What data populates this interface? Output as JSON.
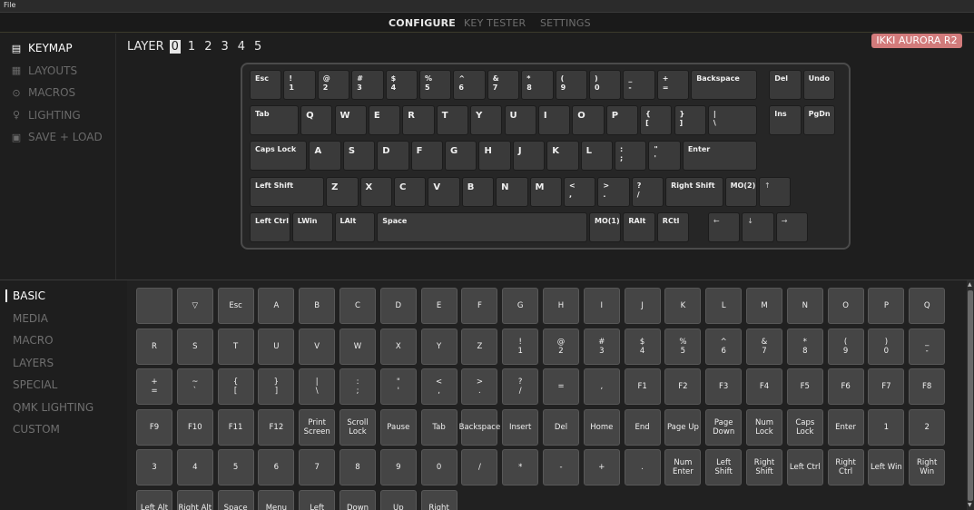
{
  "menubar": {
    "file": "File"
  },
  "topnav": {
    "tabs": [
      {
        "label": "CONFIGURE",
        "active": true
      },
      {
        "label": "KEY TESTER",
        "active": false
      },
      {
        "label": "SETTINGS",
        "active": false
      }
    ]
  },
  "upper_sidebar": {
    "items": [
      {
        "label": "KEYMAP",
        "icon": "keyboard-icon",
        "glyph": "▤",
        "active": true
      },
      {
        "label": "LAYOUTS",
        "icon": "layouts-icon",
        "glyph": "▦",
        "active": false
      },
      {
        "label": "MACROS",
        "icon": "macros-icon",
        "glyph": "⊙",
        "active": false
      },
      {
        "label": "LIGHTING",
        "icon": "lightbulb-icon",
        "glyph": "♀",
        "active": false
      },
      {
        "label": "SAVE + LOAD",
        "icon": "save-icon",
        "glyph": "▣",
        "active": false
      }
    ]
  },
  "layer": {
    "label": "LAYER",
    "numbers": [
      "0",
      "1",
      "2",
      "3",
      "4",
      "5"
    ],
    "selected": "0"
  },
  "keyboard_name": "IKKI AURORA R2",
  "keyboard": {
    "rows": [
      [
        {
          "t": "Esc",
          "w": 1
        },
        {
          "t": "!\n1",
          "w": 1
        },
        {
          "t": "@\n2",
          "w": 1
        },
        {
          "t": "#\n3",
          "w": 1
        },
        {
          "t": "$\n4",
          "w": 1
        },
        {
          "t": "%\n5",
          "w": 1
        },
        {
          "t": "^\n6",
          "w": 1
        },
        {
          "t": "&\n7",
          "w": 1
        },
        {
          "t": "*\n8",
          "w": 1
        },
        {
          "t": "(\n9",
          "w": 1
        },
        {
          "t": ")\n0",
          "w": 1
        },
        {
          "t": "_\n-",
          "w": 1
        },
        {
          "t": "+\n=",
          "w": 1
        },
        {
          "t": "Backspace",
          "w": 2
        },
        {
          "gap": 0.3
        },
        {
          "t": "Del",
          "w": 1
        },
        {
          "t": "Undo",
          "w": 1
        }
      ],
      [
        {
          "t": "Tab",
          "w": 1.5
        },
        {
          "t": "Q",
          "w": 1,
          "big": true
        },
        {
          "t": "W",
          "w": 1,
          "big": true
        },
        {
          "t": "E",
          "w": 1,
          "big": true
        },
        {
          "t": "R",
          "w": 1,
          "big": true
        },
        {
          "t": "T",
          "w": 1,
          "big": true
        },
        {
          "t": "Y",
          "w": 1,
          "big": true
        },
        {
          "t": "U",
          "w": 1,
          "big": true
        },
        {
          "t": "I",
          "w": 1,
          "big": true
        },
        {
          "t": "O",
          "w": 1,
          "big": true
        },
        {
          "t": "P",
          "w": 1,
          "big": true
        },
        {
          "t": "{\n[",
          "w": 1
        },
        {
          "t": "}\n]",
          "w": 1
        },
        {
          "t": "|\n\\",
          "w": 1.5
        },
        {
          "gap": 0.3
        },
        {
          "t": "Ins",
          "w": 1
        },
        {
          "t": "PgDn",
          "w": 1
        }
      ],
      [
        {
          "t": "Caps Lock",
          "w": 1.75
        },
        {
          "t": "A",
          "w": 1,
          "big": true
        },
        {
          "t": "S",
          "w": 1,
          "big": true
        },
        {
          "t": "D",
          "w": 1,
          "big": true
        },
        {
          "t": "F",
          "w": 1,
          "big": true
        },
        {
          "t": "G",
          "w": 1,
          "big": true
        },
        {
          "t": "H",
          "w": 1,
          "big": true
        },
        {
          "t": "J",
          "w": 1,
          "big": true
        },
        {
          "t": "K",
          "w": 1,
          "big": true
        },
        {
          "t": "L",
          "w": 1,
          "big": true
        },
        {
          "t": ":\n;",
          "w": 1
        },
        {
          "t": "\"\n'",
          "w": 1
        },
        {
          "t": "Enter",
          "w": 2.25
        }
      ],
      [
        {
          "t": "Left Shift",
          "w": 2.25
        },
        {
          "t": "Z",
          "w": 1,
          "big": true
        },
        {
          "t": "X",
          "w": 1,
          "big": true
        },
        {
          "t": "C",
          "w": 1,
          "big": true
        },
        {
          "t": "V",
          "w": 1,
          "big": true
        },
        {
          "t": "B",
          "w": 1,
          "big": true
        },
        {
          "t": "N",
          "w": 1,
          "big": true
        },
        {
          "t": "M",
          "w": 1,
          "big": true
        },
        {
          "t": "<\n,",
          "w": 1
        },
        {
          "t": ">\n.",
          "w": 1
        },
        {
          "t": "?\n/",
          "w": 1
        },
        {
          "t": "Right Shift",
          "w": 1.75
        },
        {
          "t": "MO(2)",
          "w": 1
        },
        {
          "gap": 0
        },
        {
          "t": "↑",
          "w": 1,
          "light": true
        }
      ],
      [
        {
          "t": "Left Ctrl",
          "w": 1.25
        },
        {
          "t": "LWin",
          "w": 1.25
        },
        {
          "t": "LAlt",
          "w": 1.25
        },
        {
          "t": "Space",
          "w": 6.25
        },
        {
          "t": "MO(1)",
          "w": 1
        },
        {
          "t": "RAlt",
          "w": 1
        },
        {
          "t": "RCtl",
          "w": 1
        },
        {
          "gap": 0.5
        },
        {
          "t": "←",
          "w": 1,
          "light": true
        },
        {
          "t": "↓",
          "w": 1,
          "light": true
        },
        {
          "t": "→",
          "w": 1,
          "light": true
        }
      ]
    ]
  },
  "lower_sidebar": {
    "items": [
      {
        "label": "BASIC",
        "active": true
      },
      {
        "label": "MEDIA",
        "active": false
      },
      {
        "label": "MACRO",
        "active": false
      },
      {
        "label": "LAYERS",
        "active": false
      },
      {
        "label": "SPECIAL",
        "active": false
      },
      {
        "label": "QMK LIGHTING",
        "active": false
      },
      {
        "label": "CUSTOM",
        "active": false
      }
    ]
  },
  "palette": {
    "keys": [
      "",
      "▽",
      "Esc",
      "A",
      "B",
      "C",
      "D",
      "E",
      "F",
      "G",
      "H",
      "I",
      "J",
      "K",
      "L",
      "M",
      "N",
      "O",
      "P",
      "Q",
      "R",
      "S",
      "T",
      "U",
      "V",
      "W",
      "X",
      "Y",
      "Z",
      "!\n1",
      "@\n2",
      "#\n3",
      "$\n4",
      "%\n5",
      "^\n6",
      "&\n7",
      "*\n8",
      "(\n9",
      ")\n0",
      "_\n-",
      "+\n=",
      "~\n`",
      "{\n[",
      "}\n]",
      "|\n\\",
      ":\n;",
      "\"\n'",
      "<\n,",
      ">\n.",
      "?\n/",
      "=",
      ",",
      "F1",
      "F2",
      "F3",
      "F4",
      "F5",
      "F6",
      "F7",
      "F8",
      "F9",
      "F10",
      "F11",
      "F12",
      "Print\nScreen",
      "Scroll\nLock",
      "Pause",
      "Tab",
      "Backspace",
      "Insert",
      "Del",
      "Home",
      "End",
      "Page Up",
      "Page\nDown",
      "Num\nLock",
      "Caps\nLock",
      "Enter",
      "1",
      "2",
      "3",
      "4",
      "5",
      "6",
      "7",
      "8",
      "9",
      "0",
      "/",
      "*",
      "-",
      "+",
      ".",
      "Num\nEnter",
      "Left\nShift",
      "Right\nShift",
      "Left Ctrl",
      "Right\nCtrl",
      "Left Win",
      "Right\nWin",
      "Left Alt",
      "Right Alt",
      "Space",
      "Menu",
      "Left",
      "Down",
      "Up",
      "Right"
    ]
  }
}
